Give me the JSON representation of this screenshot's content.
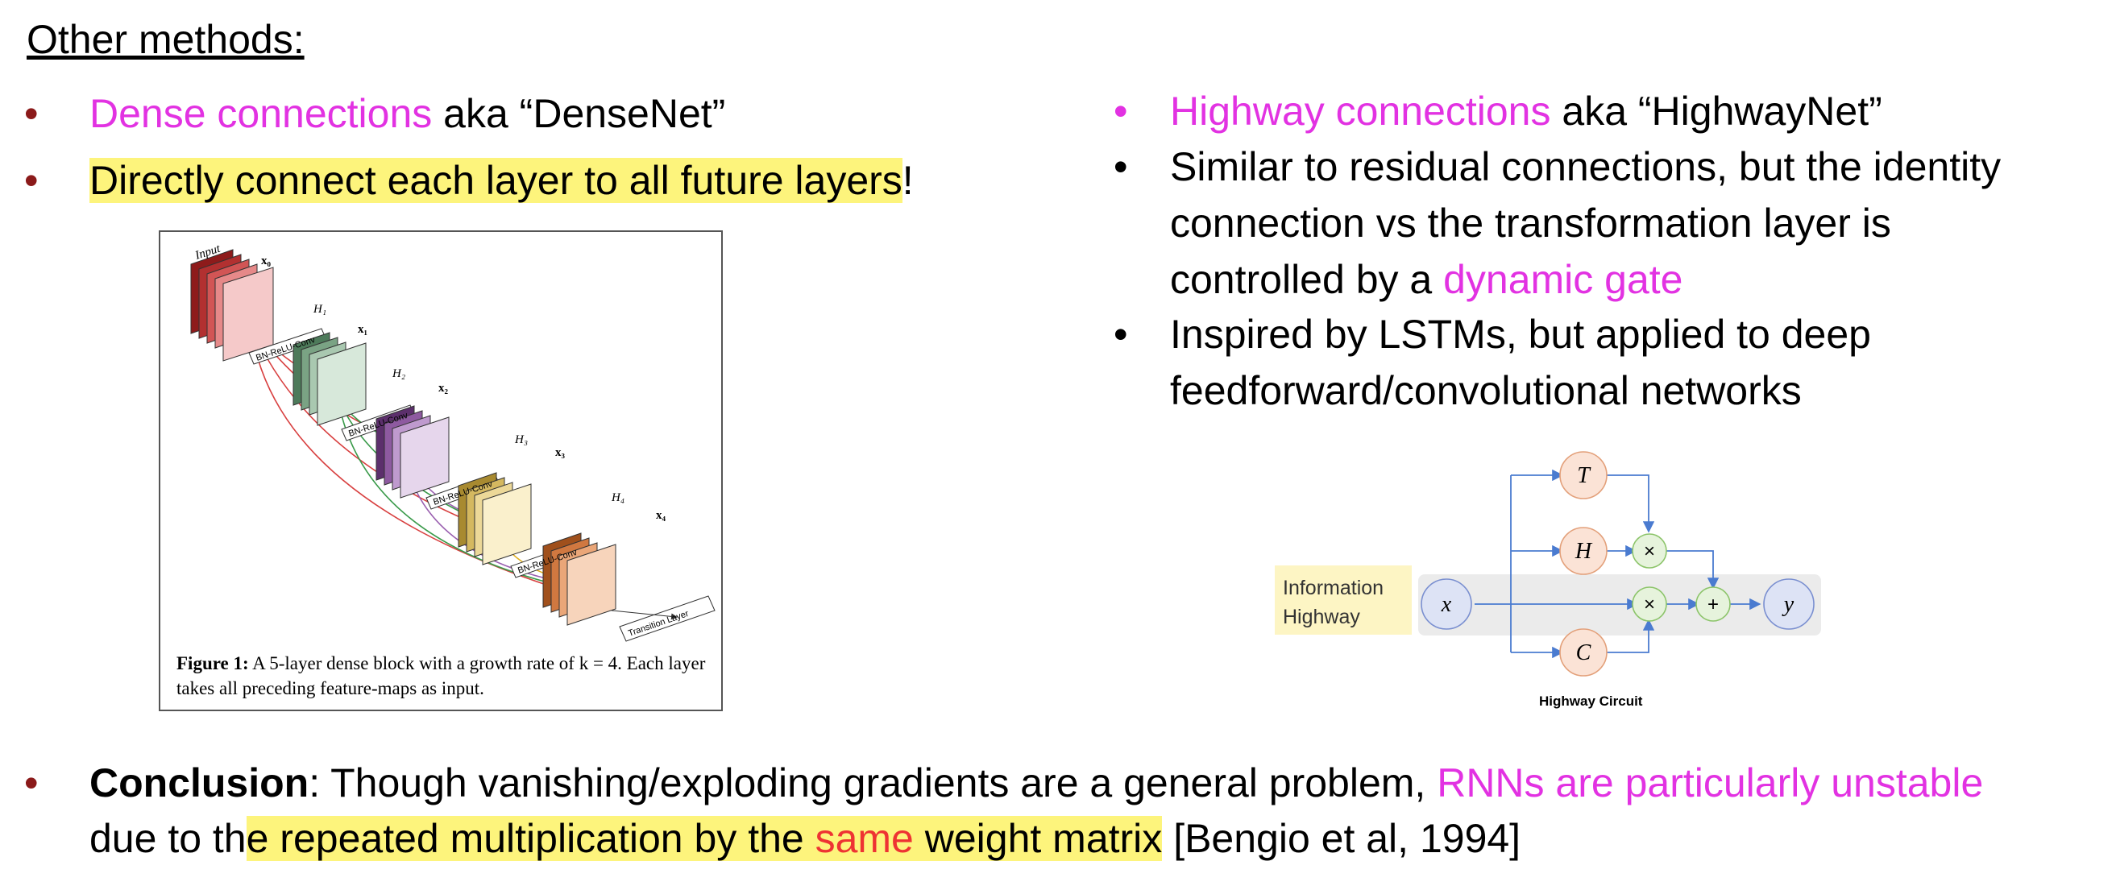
{
  "heading": "Other methods:",
  "left": {
    "b1": {
      "magenta": "Dense connections",
      "rest": " aka “DenseNet”"
    },
    "b2": {
      "highlight": "Directly connect each layer to all future layers",
      "rest": "!"
    }
  },
  "figure1": {
    "caption_bold": "Figure 1:",
    "caption_text": " A 5-layer dense block with a growth rate of k = 4. Each layer takes all preceding feature-maps as input.",
    "labels": {
      "input": "Input",
      "x0": "x₀",
      "x1": "x₁",
      "x2": "x₂",
      "x3": "x₃",
      "x4": "x₄",
      "h1": "H₁",
      "h2": "H₂",
      "h3": "H₃",
      "h4": "H₄",
      "conv": "BN-ReLU-Conv",
      "transition": "Transition Layer"
    }
  },
  "right": {
    "b1": {
      "magenta": "Highway connections",
      "rest": " aka “HighwayNet”"
    },
    "b2": {
      "line1": "Similar to residual connections, but the identity",
      "line2": "connection vs the transformation layer is",
      "line3_pre": "controlled by a ",
      "line3_magenta": "dynamic gate"
    },
    "b3": {
      "line1": "Inspired by LSTMs, but applied to deep",
      "line2": "feedforward/convolutional networks"
    }
  },
  "highway": {
    "info_label_1": "Information",
    "info_label_2": "Highway",
    "x": "x",
    "y": "y",
    "T": "T",
    "H": "H",
    "C": "C",
    "times": "×",
    "plus": "+",
    "caption": "Highway Circuit"
  },
  "conclusion": {
    "bold": "Conclusion",
    "text1": ": Though vanishing/exploding gradients are a general problem, ",
    "magenta": "RNNs are particularly unstable",
    "line2_pre": "due to th",
    "hl1": "e repeated multiplication by the ",
    "red": "same",
    "hl2": " weight matrix",
    "cite": " [Bengio et al, 1994]"
  },
  "colors": {
    "magenta": "#e232e2",
    "highlight": "#fdf47c",
    "bullet_red": "#8b1a1a",
    "red_word": "#ee3333",
    "node_orange_fill": "#fbe3d6",
    "node_orange_stroke": "#e3a07a",
    "node_green_fill": "#e6f3dc",
    "node_green_stroke": "#8cc46a",
    "node_blue_fill": "#dde3f5",
    "node_blue_stroke": "#7a8fd0",
    "arrow_blue": "#4a7bd0"
  },
  "icons": [
    "bullet-icon"
  ]
}
